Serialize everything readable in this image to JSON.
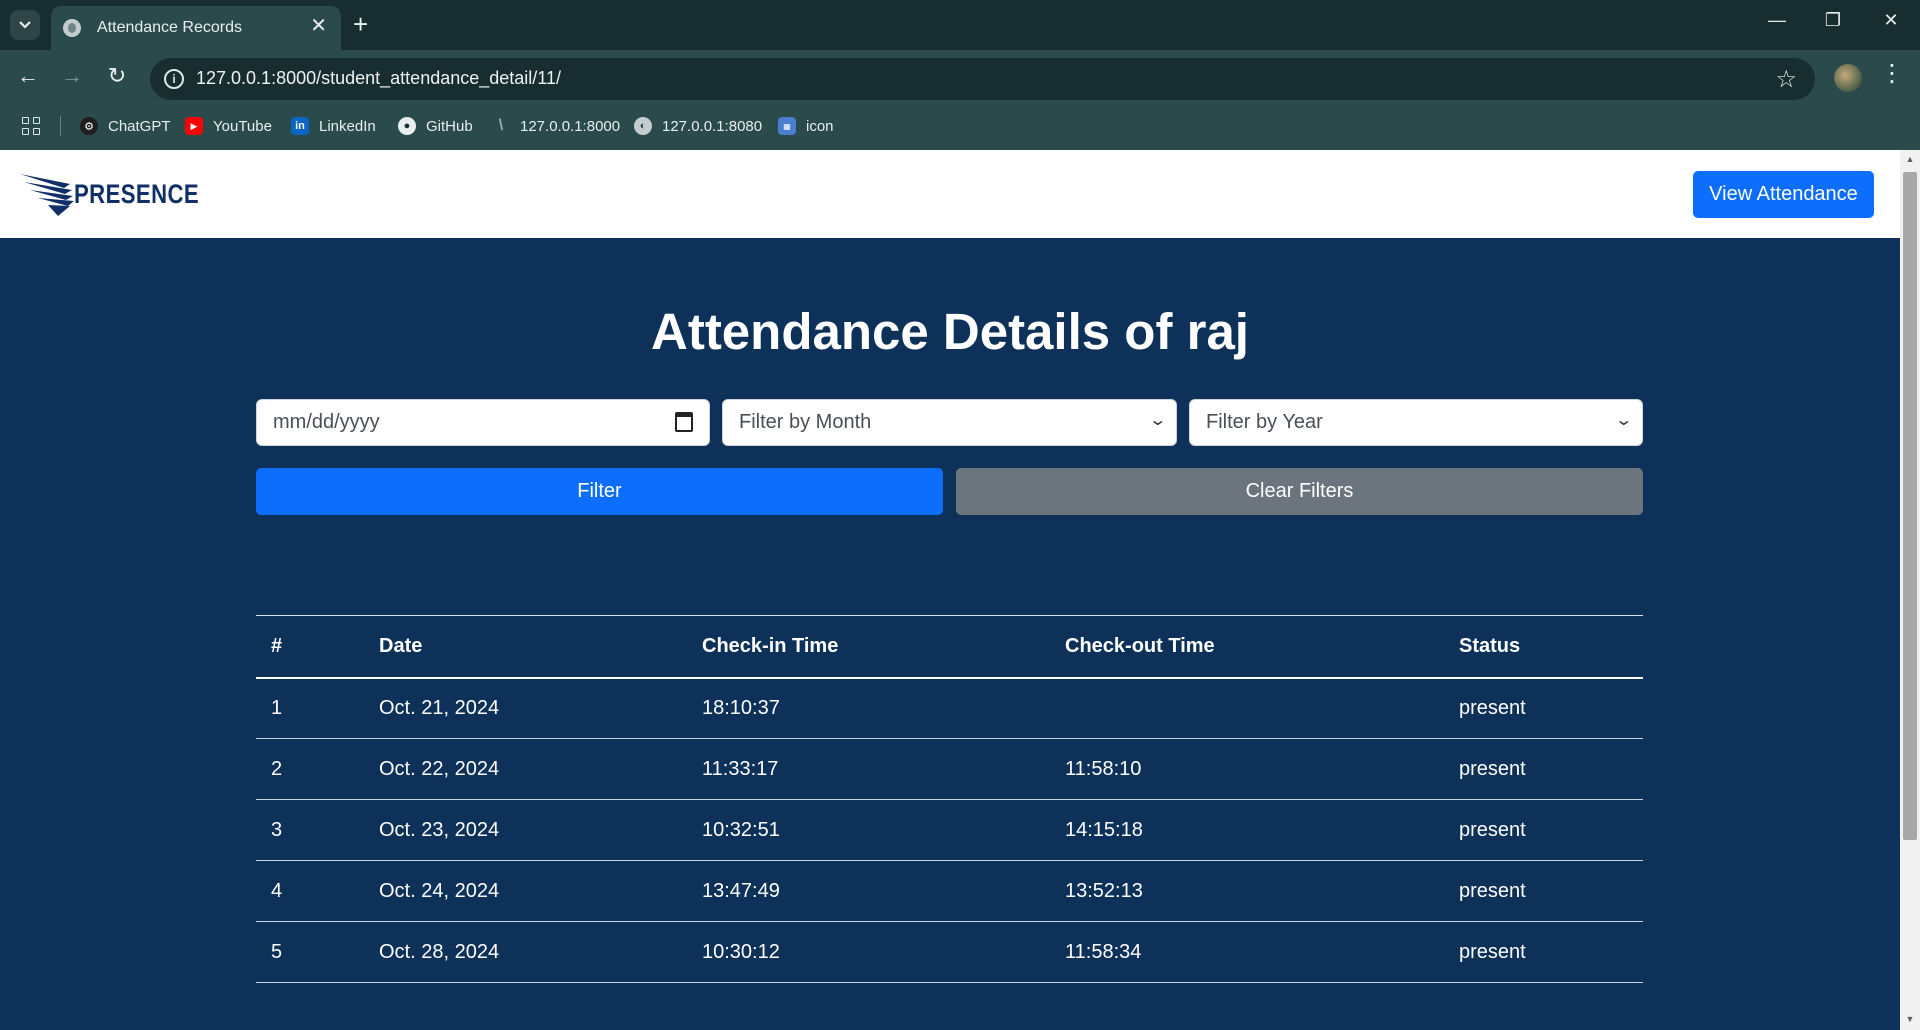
{
  "browser": {
    "tab_title": "Attendance Records",
    "url": "127.0.0.1:8000/student_attendance_detail/11/",
    "bookmarks": [
      {
        "label": "ChatGPT",
        "icon": "chatgpt-icon"
      },
      {
        "label": "YouTube",
        "icon": "youtube-icon"
      },
      {
        "label": "LinkedIn",
        "icon": "linkedin-icon"
      },
      {
        "label": "GitHub",
        "icon": "github-icon"
      },
      {
        "label": "127.0.0.1:8000",
        "icon": "django-icon"
      },
      {
        "label": "127.0.0.1:8080",
        "icon": "globe-icon"
      },
      {
        "label": "icon",
        "icon": "image-icon"
      }
    ]
  },
  "navbar": {
    "brand": "PRESENCE",
    "view_attendance_label": "View Attendance"
  },
  "page": {
    "title": "Attendance Details of raj",
    "filters": {
      "date_placeholder": "mm/dd/yyyy",
      "month_selected": "Filter by Month",
      "year_selected": "Filter by Year",
      "filter_label": "Filter",
      "clear_label": "Clear Filters"
    },
    "table": {
      "headers": [
        "#",
        "Date",
        "Check-in Time",
        "Check-out Time",
        "Status"
      ],
      "rows": [
        [
          "1",
          "Oct. 21, 2024",
          "18:10:37",
          "",
          "present"
        ],
        [
          "2",
          "Oct. 22, 2024",
          "11:33:17",
          "11:58:10",
          "present"
        ],
        [
          "3",
          "Oct. 23, 2024",
          "10:32:51",
          "14:15:18",
          "present"
        ],
        [
          "4",
          "Oct. 24, 2024",
          "13:47:49",
          "13:52:13",
          "present"
        ],
        [
          "5",
          "Oct. 28, 2024",
          "10:30:12",
          "11:58:34",
          "present"
        ]
      ]
    }
  },
  "colors": {
    "page_background": "#0d3158",
    "primary": "#0d6efd",
    "secondary": "#6c757d",
    "brand": "#0f2f66"
  }
}
